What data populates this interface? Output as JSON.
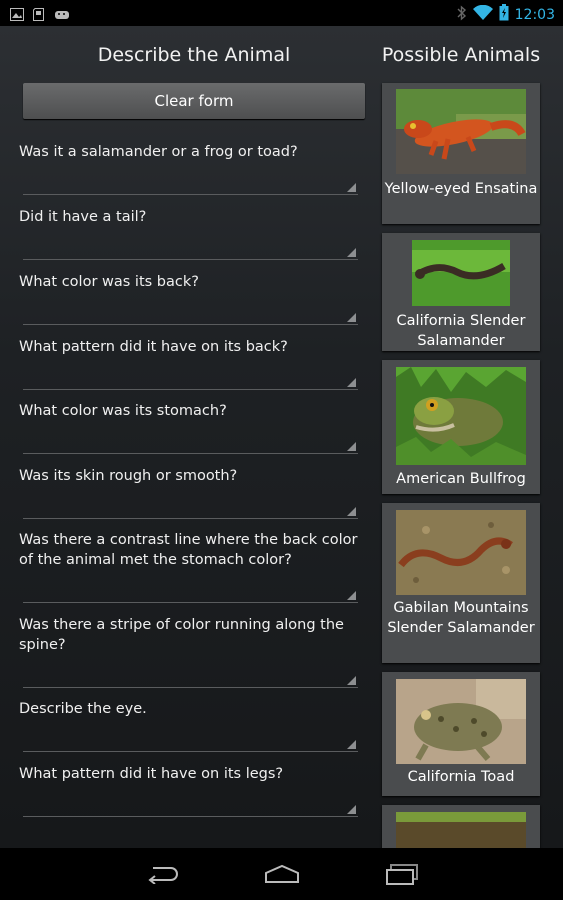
{
  "status_bar": {
    "time": "12:03",
    "left_icons": [
      "gallery-icon",
      "sd-card-icon",
      "android-robot-icon"
    ],
    "right_icons": [
      "bluetooth-icon",
      "wifi-icon",
      "battery-icon"
    ]
  },
  "left_column": {
    "title": "Describe the Animal",
    "clear_button": "Clear form",
    "questions": [
      "Was it a salamander or a frog or toad?",
      "Did it have a tail?",
      "What color was its back?",
      "What pattern did it have on its back?",
      "What color was its stomach?",
      "Was its skin rough or smooth?",
      "Was there a contrast line where the back color of the animal met the stomach color?",
      "Was there a stripe of color running along the spine?",
      "Describe the eye.",
      "What pattern did it have on its legs?"
    ]
  },
  "right_column": {
    "title": "Possible Animals",
    "animals": [
      "Yellow-eyed Ensatina",
      "California Slender Salamander",
      "American Bullfrog",
      "Gabilan Mountains Slender Salamander",
      "California Toad"
    ]
  },
  "nav_bar": {
    "buttons": [
      "back-icon",
      "home-icon",
      "recent-apps-icon"
    ]
  },
  "colors": {
    "accent": "#33b5e5",
    "background": "#1e2124",
    "card": "#4a4c4e",
    "button": "#5c5d5e"
  }
}
